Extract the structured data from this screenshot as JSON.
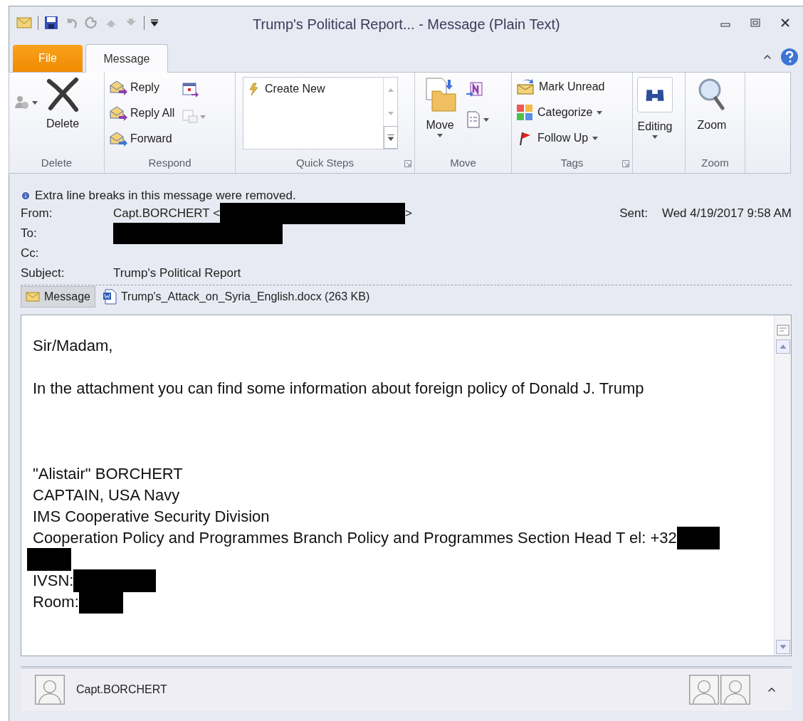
{
  "window": {
    "title": "Trump's Political Report... - Message (Plain Text)"
  },
  "tabs": [
    {
      "label": "File",
      "kind": "file",
      "selected": false
    },
    {
      "label": "Message",
      "kind": "tab",
      "selected": true
    }
  ],
  "ribbon": {
    "groups": [
      {
        "label": "Delete",
        "buttons": [
          {
            "label": "Delete"
          }
        ]
      },
      {
        "label": "Respond",
        "buttons": [
          {
            "label": "Reply"
          },
          {
            "label": "Reply All"
          },
          {
            "label": "Forward"
          }
        ]
      },
      {
        "label": "Quick Steps",
        "buttons": [
          {
            "label": "Create New"
          }
        ]
      },
      {
        "label": "Move",
        "buttons": [
          {
            "label": "Move"
          }
        ]
      },
      {
        "label": "Tags",
        "buttons": [
          {
            "label": "Mark Unread"
          },
          {
            "label": "Categorize"
          },
          {
            "label": "Follow Up"
          }
        ]
      },
      {
        "buttons": [
          {
            "label": "Editing"
          }
        ]
      },
      {
        "label": "Zoom",
        "buttons": [
          {
            "label": "Zoom"
          }
        ]
      }
    ]
  },
  "info_bar": "Extra line breaks in this message were removed.",
  "header": {
    "fields": [
      {
        "label": "From:",
        "before": "Capt.BORCHERT <",
        "redacted": true,
        "after": ">"
      },
      {
        "label": "To:",
        "redacted": true
      },
      {
        "label": "Cc:",
        "redacted": false
      },
      {
        "label": "Subject:",
        "before": "Trump's Political Report",
        "redacted": false
      }
    ],
    "sent": {
      "label": "Sent:",
      "value": "Wed 4/19/2017 9:58 AM"
    }
  },
  "attachments": [
    {
      "label": "Message",
      "kind": "message",
      "selected": true
    },
    {
      "label": "Trump's_Attack_on_Syria_English.docx (263 KB)",
      "kind": "file",
      "selected": false
    }
  ],
  "body": {
    "paragraphs": [
      {
        "kind": "text",
        "lines": [
          {
            "text": "Sir/Madam,",
            "redacted": false
          }
        ]
      },
      {
        "kind": "text",
        "lines": [
          {
            "text": "In the attachment you can find some information about foreign policy of Donald J. Trump",
            "redacted": false
          }
        ]
      },
      {
        "kind": "signature",
        "lines": [
          {
            "text": "\"Alistair\" BORCHERT",
            "redacted": false
          },
          {
            "text": "CAPTAIN, USA Navy",
            "redacted": false
          },
          {
            "text": "IMS Cooperative Security Division",
            "redacted": false
          },
          {
            "text": "Cooperation Policy and Programmes Branch Policy and Programmes Section Head T el: +32",
            "redacted": true
          },
          {
            "redacted": true
          },
          {
            "text": "IVSN:",
            "redacted": true
          },
          {
            "text": "Room:",
            "redacted": true
          }
        ]
      }
    ]
  },
  "people_pane": {
    "name": "Capt.BORCHERT"
  }
}
